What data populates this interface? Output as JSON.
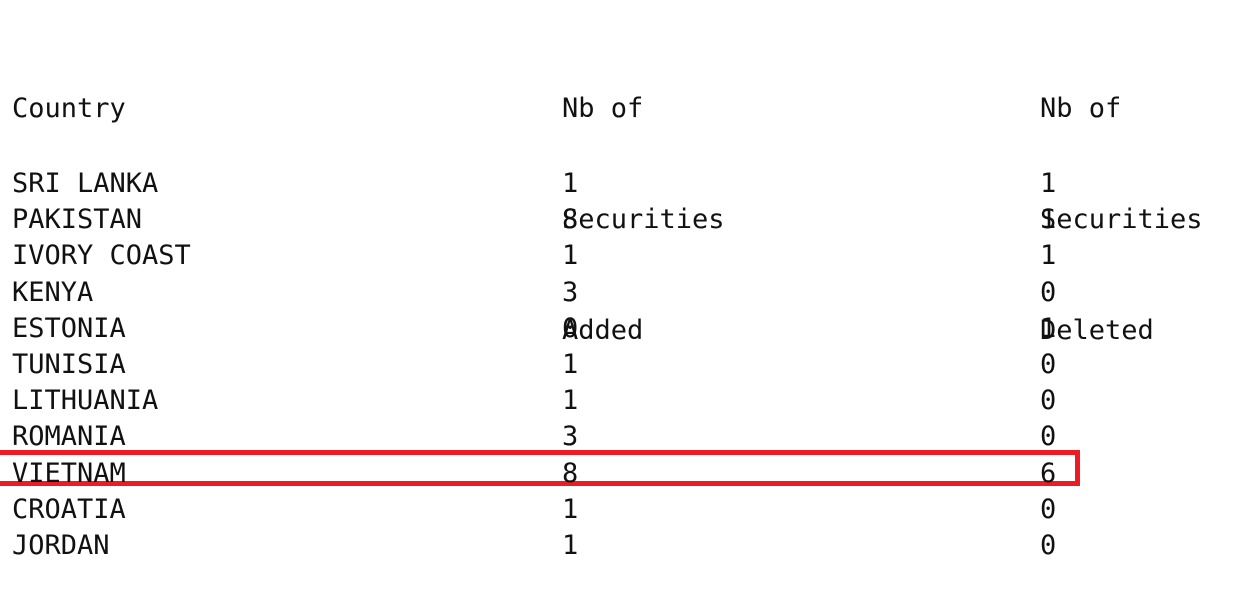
{
  "table": {
    "headers": {
      "country": "Country",
      "added": [
        "Nb of",
        "Securities",
        "Added"
      ],
      "deleted": [
        "Nb of",
        "Securities",
        "Deleted"
      ]
    },
    "rows": [
      {
        "country": "SRI LANKA",
        "added": "1",
        "deleted": "1",
        "highlighted": false
      },
      {
        "country": "PAKISTAN",
        "added": "8",
        "deleted": "1",
        "highlighted": false
      },
      {
        "country": "IVORY COAST",
        "added": "1",
        "deleted": "1",
        "highlighted": false
      },
      {
        "country": "KENYA",
        "added": "3",
        "deleted": "0",
        "highlighted": false
      },
      {
        "country": "ESTONIA",
        "added": "0",
        "deleted": "1",
        "highlighted": false
      },
      {
        "country": "TUNISIA",
        "added": "1",
        "deleted": "0",
        "highlighted": false
      },
      {
        "country": "LITHUANIA",
        "added": "1",
        "deleted": "0",
        "highlighted": false
      },
      {
        "country": "ROMANIA",
        "added": "3",
        "deleted": "0",
        "highlighted": false
      },
      {
        "country": "VIETNAM",
        "added": "8",
        "deleted": "6",
        "highlighted": true
      },
      {
        "country": "CROATIA",
        "added": "1",
        "deleted": "0",
        "highlighted": false
      },
      {
        "country": "JORDAN",
        "added": "1",
        "deleted": "0",
        "highlighted": false
      }
    ],
    "highlight_color": "#ED1C24",
    "text_color": "#111111",
    "background_color": "#FFFFFF"
  }
}
